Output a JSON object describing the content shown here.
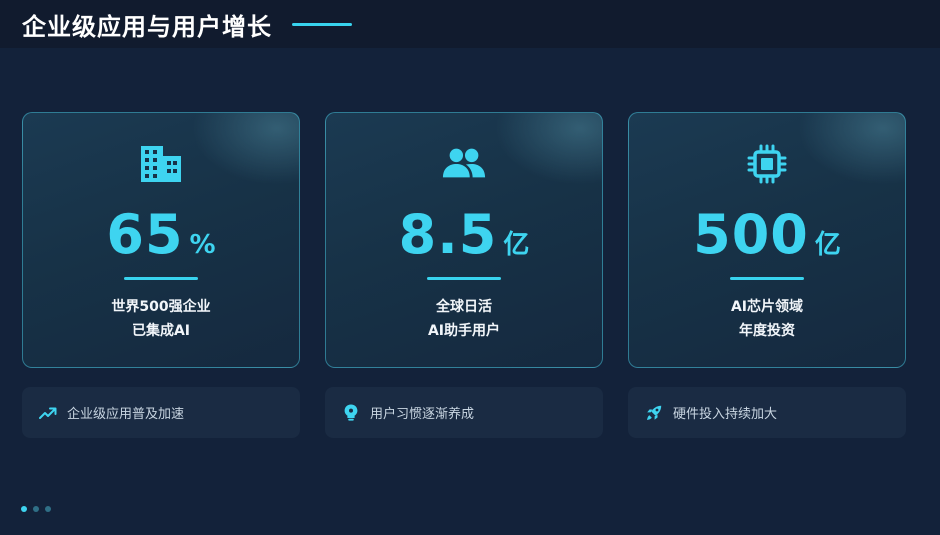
{
  "header": {
    "title": "企业级应用与用户增长"
  },
  "cards": [
    {
      "icon": "building-icon",
      "value": "65",
      "unit": "%",
      "desc_line1": "世界500强企业",
      "desc_line2": "已集成AI"
    },
    {
      "icon": "users-icon",
      "value": "8.5",
      "unit": "亿",
      "desc_line1": "全球日活",
      "desc_line2": "AI助手用户"
    },
    {
      "icon": "chip-icon",
      "value": "500",
      "unit": "亿",
      "desc_line1": "AI芯片领域",
      "desc_line2": "年度投资"
    }
  ],
  "notes": [
    {
      "icon": "trending-up-icon",
      "text": "企业级应用普及加速"
    },
    {
      "icon": "lightbulb-head-icon",
      "text": "用户习惯逐渐养成"
    },
    {
      "icon": "rocket-icon",
      "text": "硬件投入持续加大"
    }
  ],
  "pagination": {
    "count": 3,
    "active": 0
  },
  "colors": {
    "accent": "#3ed4f0",
    "background": "#13223a",
    "header": "#111b2e"
  }
}
